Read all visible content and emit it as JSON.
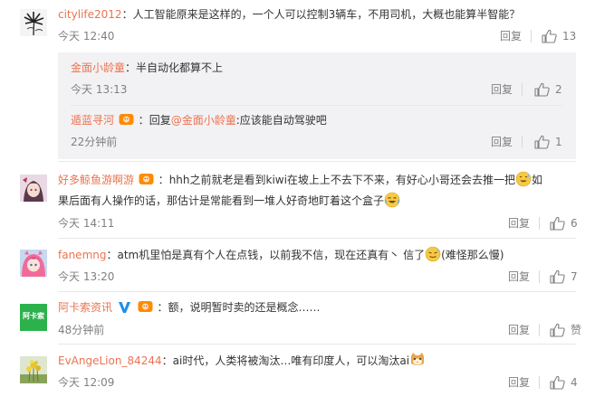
{
  "comments": [
    {
      "username": "citylife2012",
      "text": "人工智能原来是这样的，一个人可以控制3辆车，不用司机，大概也能算半智能？",
      "time": "今天 12:40",
      "reply_label": "回复",
      "likes": "13",
      "avatar": "black-white-palm-avatar",
      "replies": [
        {
          "username": "金面小龄童",
          "text": "半自动化都算不上",
          "time": "今天 13:13",
          "reply_label": "回复",
          "likes": "2"
        },
        {
          "username": "遁蓝寻河",
          "reply_prefix": "回复",
          "mention": "@金面小龄童",
          "text": ":应该能自动驾驶吧",
          "time": "22分钟前",
          "reply_label": "回复",
          "likes": "1",
          "badge": "member-badge-icon"
        }
      ]
    },
    {
      "username": "好多鲸鱼游啊游",
      "text_part1": "hhh之前就老是看到kiwi在坡上上不去下不来，有好心小哥还会去推一把",
      "text_part2": "如",
      "text_line2": "果后面有人操作的话，那估计是常能看到一堆人好奇地盯着这个盒子",
      "time": "今天 14:11",
      "reply_label": "回复",
      "likes": "6",
      "avatar": "anime-girl-avatar",
      "badge": "member-badge-icon"
    },
    {
      "username": "fanemng",
      "text_part1": "atm机里怕是真有个人在点钱，以前我不信，现在还真有丶 信了",
      "text_part2": "(难怪那么慢)",
      "time": "今天 13:20",
      "reply_label": "回复",
      "likes": "7",
      "avatar": "pink-hair-avatar"
    },
    {
      "username": "阿卡索资讯",
      "text": "额，说明暂时卖的还是概念……",
      "time": "48分钟前",
      "reply_label": "回复",
      "likes": "赞",
      "avatar": "brand-logo-avatar",
      "avatar_text": "阿卡索",
      "badge": "member-badge-icon",
      "verified": "verified-v-icon"
    },
    {
      "username": "EvAngeLion_84244",
      "text": "ai时代，人类将被淘汰…唯有印度人，可以淘汰ai",
      "time": "今天 12:09",
      "reply_label": "回复",
      "likes": "4",
      "avatar": "yellow-flowers-avatar"
    }
  ],
  "colors": {
    "username": "#eb7350",
    "text": "#333333",
    "meta": "#808080",
    "reply_box": "#f2f2f5",
    "avatar_brand": "#2bb24c"
  }
}
